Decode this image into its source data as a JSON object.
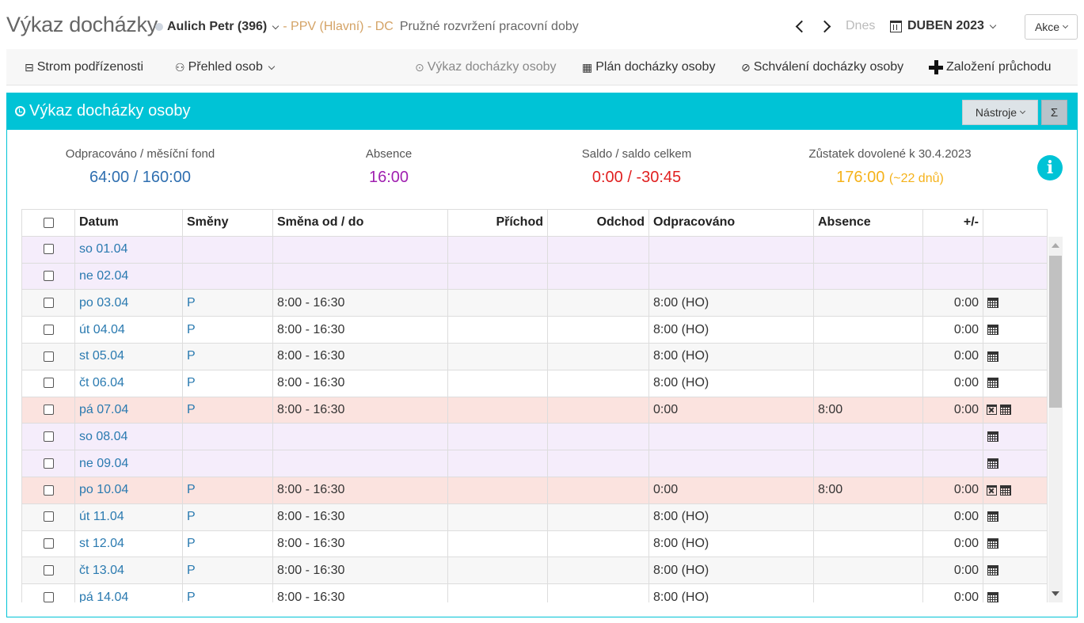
{
  "header": {
    "title": "Výkaz docházky",
    "person_name": "Aulich Petr (396)",
    "person_org": "- PPV (Hlavní) - DC",
    "person_regime": "Pružné rozvržení pracovní doby",
    "today": "Dnes",
    "month": "DUBEN 2023",
    "actions": "Akce"
  },
  "toolbar": {
    "tree": "Strom podřízenosti",
    "overview": "Přehled osob",
    "report": "Výkaz docházky osoby",
    "plan": "Plán docházky osoby",
    "approval": "Schválení docházky osoby",
    "new_pass": "Založení průchodu"
  },
  "panel": {
    "title": "Výkaz docházky osoby",
    "tools": "Nástroje",
    "sum": "Σ"
  },
  "stats": {
    "worked_label": "Odpracováno / měsíční fond",
    "worked_value": "64:00 / 160:00",
    "absence_label": "Absence",
    "absence_value": "16:00",
    "saldo_label": "Saldo / saldo celkem",
    "saldo_value": "0:00 / -30:45",
    "vacation_label": "Zůstatek dovolené k 30.4.2023",
    "vacation_value": "176:00",
    "vacation_days": "(~22 dnů)",
    "colors": {
      "worked": "#2f6fb0",
      "absence": "#a020b0",
      "saldo": "#e02020",
      "vacation": "#f5b21a"
    }
  },
  "table": {
    "headers": [
      "Datum",
      "Směny",
      "Směna od / do",
      "Příchod",
      "Odchod",
      "Odpracováno",
      "Absence",
      "+/-"
    ],
    "rows": [
      {
        "date": "so 01.04",
        "shift": "",
        "span": "",
        "in": "",
        "out": "",
        "worked": "",
        "absence": "",
        "diff": "",
        "icons": "",
        "type": "weekend"
      },
      {
        "date": "ne 02.04",
        "shift": "",
        "span": "",
        "in": "",
        "out": "",
        "worked": "",
        "absence": "",
        "diff": "",
        "icons": "",
        "type": "weekend"
      },
      {
        "date": "po 03.04",
        "shift": "P",
        "span": "8:00 - 16:30",
        "in": "",
        "out": "",
        "worked": "8:00 (HO)",
        "absence": "",
        "diff": "0:00",
        "icons": "cal",
        "type": "even"
      },
      {
        "date": "út 04.04",
        "shift": "P",
        "span": "8:00 - 16:30",
        "in": "",
        "out": "",
        "worked": "8:00 (HO)",
        "absence": "",
        "diff": "0:00",
        "icons": "cal",
        "type": "odd"
      },
      {
        "date": "st 05.04",
        "shift": "P",
        "span": "8:00 - 16:30",
        "in": "",
        "out": "",
        "worked": "8:00 (HO)",
        "absence": "",
        "diff": "0:00",
        "icons": "cal",
        "type": "even"
      },
      {
        "date": "čt 06.04",
        "shift": "P",
        "span": "8:00 - 16:30",
        "in": "",
        "out": "",
        "worked": "8:00 (HO)",
        "absence": "",
        "diff": "0:00",
        "icons": "cal",
        "type": "odd"
      },
      {
        "date": "pá 07.04",
        "shift": "P",
        "span": "8:00 - 16:30",
        "in": "",
        "out": "",
        "worked": "0:00",
        "absence": "8:00",
        "diff": "0:00",
        "icons": "x-cal",
        "type": "absent"
      },
      {
        "date": "so 08.04",
        "shift": "",
        "span": "",
        "in": "",
        "out": "",
        "worked": "",
        "absence": "",
        "diff": "",
        "icons": "cal",
        "type": "weekend"
      },
      {
        "date": "ne 09.04",
        "shift": "",
        "span": "",
        "in": "",
        "out": "",
        "worked": "",
        "absence": "",
        "diff": "",
        "icons": "cal",
        "type": "weekend"
      },
      {
        "date": "po 10.04",
        "shift": "P",
        "span": "8:00 - 16:30",
        "in": "",
        "out": "",
        "worked": "0:00",
        "absence": "8:00",
        "diff": "0:00",
        "icons": "x-cal",
        "type": "absent"
      },
      {
        "date": "út 11.04",
        "shift": "P",
        "span": "8:00 - 16:30",
        "in": "",
        "out": "",
        "worked": "8:00 (HO)",
        "absence": "",
        "diff": "0:00",
        "icons": "cal",
        "type": "even"
      },
      {
        "date": "st 12.04",
        "shift": "P",
        "span": "8:00 - 16:30",
        "in": "",
        "out": "",
        "worked": "8:00 (HO)",
        "absence": "",
        "diff": "0:00",
        "icons": "cal",
        "type": "odd"
      },
      {
        "date": "čt 13.04",
        "shift": "P",
        "span": "8:00 - 16:30",
        "in": "",
        "out": "",
        "worked": "8:00 (HO)",
        "absence": "",
        "diff": "0:00",
        "icons": "cal",
        "type": "even"
      },
      {
        "date": "pá 14.04",
        "shift": "P",
        "span": "8:00 - 16:30",
        "in": "",
        "out": "",
        "worked": "8:00 (HO)",
        "absence": "",
        "diff": "0:00",
        "icons": "cal",
        "type": "odd"
      }
    ]
  }
}
